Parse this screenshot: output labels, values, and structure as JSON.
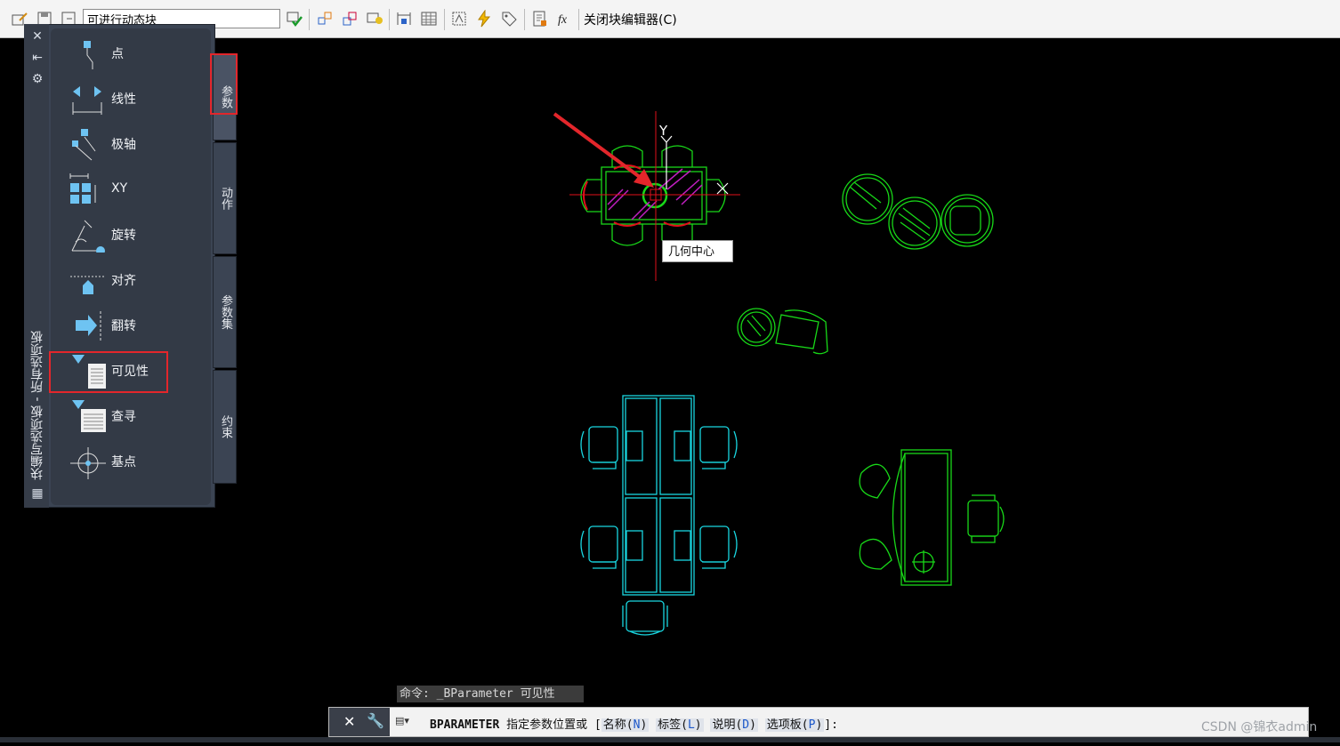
{
  "toolbar": {
    "block_name_value": "可进行动态块",
    "close_editor_label": "关闭块编辑器(C)"
  },
  "palette": {
    "title": "块编写选项板 - 所有选项板",
    "items": [
      {
        "label": "点"
      },
      {
        "label": "线性"
      },
      {
        "label": "极轴"
      },
      {
        "label": "XY"
      },
      {
        "label": "旋转"
      },
      {
        "label": "对齐"
      },
      {
        "label": "翻转"
      },
      {
        "label": "可见性"
      },
      {
        "label": "查寻"
      },
      {
        "label": "基点"
      }
    ],
    "tabs": [
      "参数",
      "动作",
      "参数集",
      "约束"
    ],
    "active_tab": "参数",
    "highlighted_item": "可见性"
  },
  "drawing": {
    "ucs_y_label": "Y",
    "tooltip": "几何中心"
  },
  "command": {
    "history": "命令: _BParameter 可见性",
    "keyword": "BPARAMETER",
    "prompt": "指定参数位置或",
    "bracket_open": "[",
    "options": [
      {
        "label": "名称",
        "key": "N"
      },
      {
        "label": "标签",
        "key": "L"
      },
      {
        "label": "说明",
        "key": "D"
      },
      {
        "label": "选项板",
        "key": "P"
      }
    ],
    "bracket_close": "]:"
  },
  "watermark": "CSDN @锦衣admin",
  "colors": {
    "highlight": "#e3262b",
    "green_geometry": "#18d818",
    "cyan_geometry": "#19d6e0",
    "magenta_hatch": "#c11fc1",
    "crosshair": "#e0101a"
  }
}
